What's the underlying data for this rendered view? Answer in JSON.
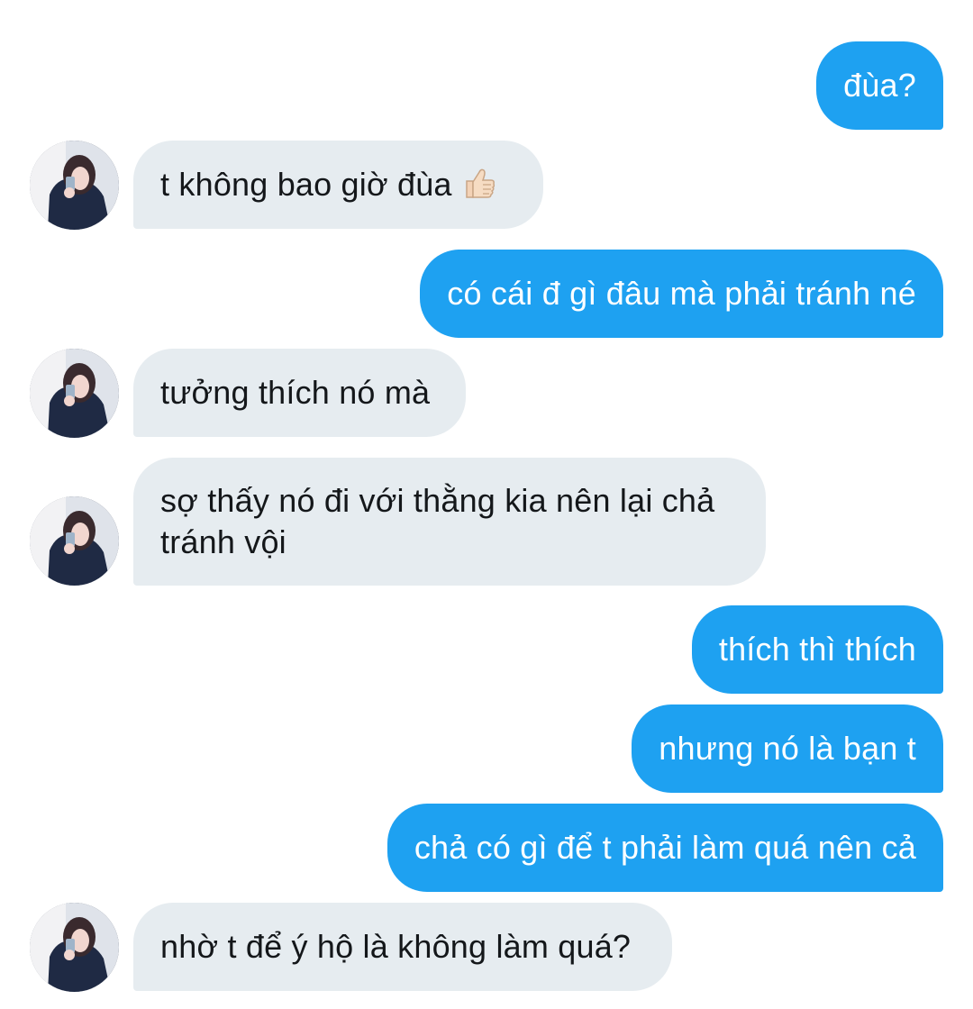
{
  "messages": [
    {
      "side": "out",
      "text": "đùa?"
    },
    {
      "side": "in",
      "text": "t không bao giờ đùa",
      "emoji": "thumbs-up"
    },
    {
      "side": "out",
      "text": "có cái đ gì đâu mà phải tránh né"
    },
    {
      "side": "in",
      "text": "tưởng thích nó mà"
    },
    {
      "side": "in",
      "text": "sợ thấy nó đi với thằng kia nên lại chả tránh vội"
    },
    {
      "side": "out",
      "text": "thích thì thích"
    },
    {
      "side": "out",
      "text": "nhưng nó là bạn t"
    },
    {
      "side": "out",
      "text": "chả có gì để t phải làm quá nên cả"
    },
    {
      "side": "in",
      "text": "nhờ t để ý hộ là không làm quá?"
    }
  ],
  "colors": {
    "outgoing_bubble": "#1ea1f1",
    "incoming_bubble": "#e6ecf0",
    "incoming_text": "#14171a",
    "outgoing_text": "#ffffff"
  }
}
